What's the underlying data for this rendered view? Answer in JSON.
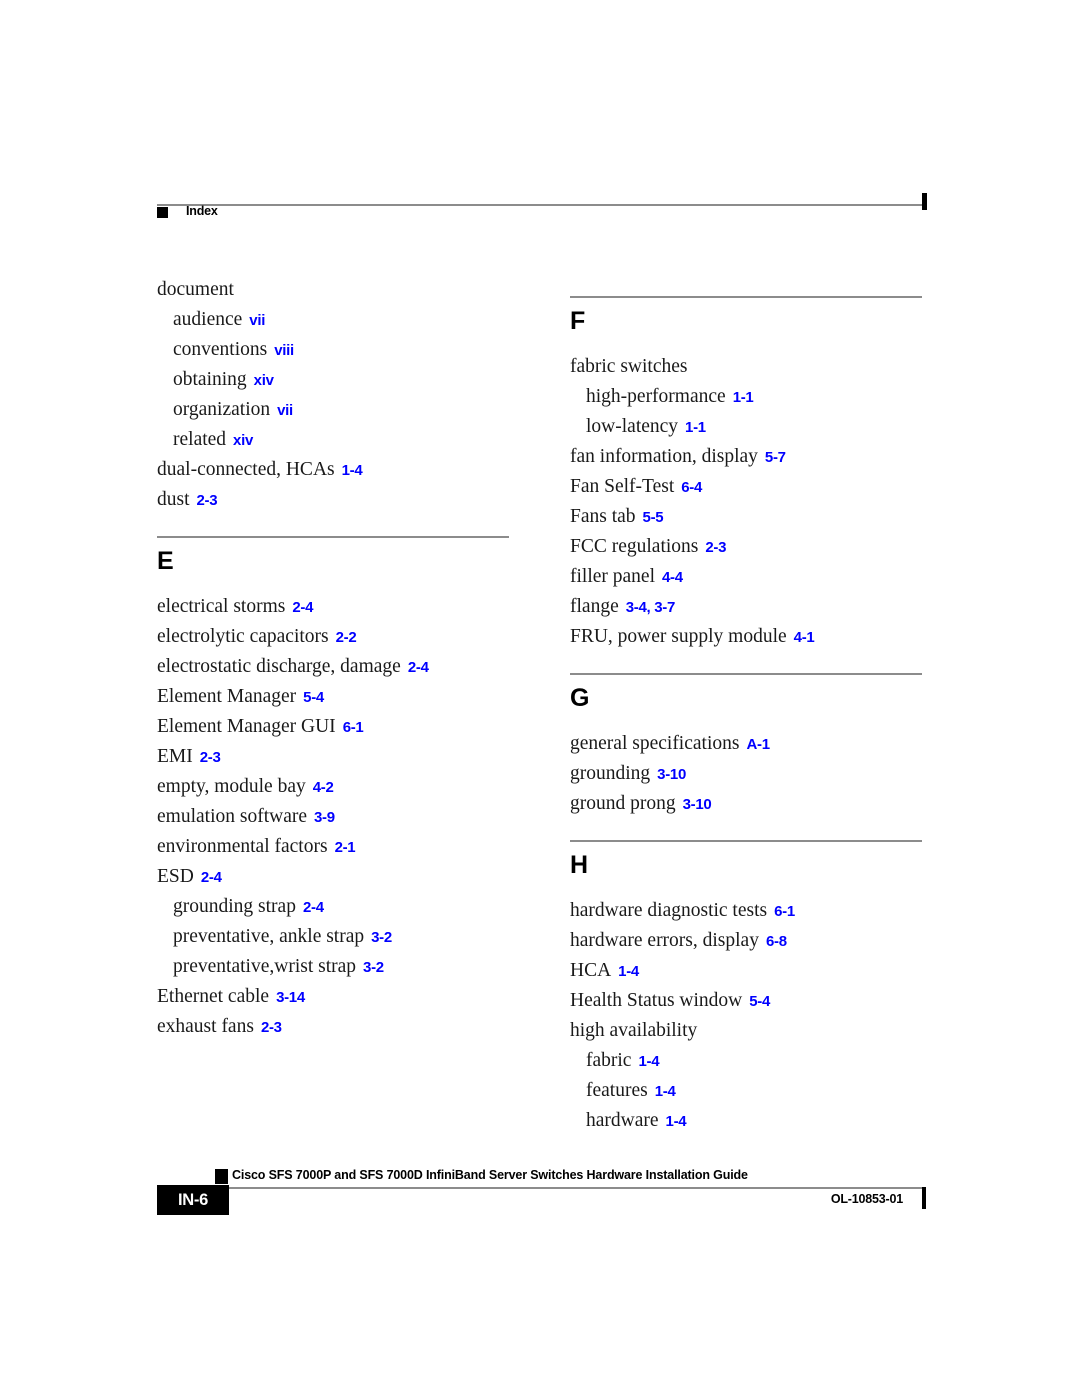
{
  "header": {
    "label": "Index"
  },
  "columns": [
    {
      "name": "left-column",
      "sections": [
        {
          "letter": "",
          "has_divider": false,
          "entries": [
            {
              "term": "document",
              "pages": "",
              "level": 0
            },
            {
              "term": "audience",
              "pages": "vii",
              "level": 1
            },
            {
              "term": "conventions",
              "pages": "viii",
              "level": 1
            },
            {
              "term": "obtaining",
              "pages": "xiv",
              "level": 1
            },
            {
              "term": "organization",
              "pages": "vii",
              "level": 1
            },
            {
              "term": "related",
              "pages": "xiv",
              "level": 1
            },
            {
              "term": "dual-connected, HCAs",
              "pages": "1-4",
              "level": 0
            },
            {
              "term": "dust",
              "pages": "2-3",
              "level": 0
            }
          ]
        },
        {
          "letter": "E",
          "has_divider": true,
          "entries": [
            {
              "term": "electrical storms",
              "pages": "2-4",
              "level": 0
            },
            {
              "term": "electrolytic capacitors",
              "pages": "2-2",
              "level": 0
            },
            {
              "term": "electrostatic discharge, damage",
              "pages": "2-4",
              "level": 0
            },
            {
              "term": "Element Manager",
              "pages": "5-4",
              "level": 0
            },
            {
              "term": "Element Manager GUI",
              "pages": "6-1",
              "level": 0
            },
            {
              "term": "EMI",
              "pages": "2-3",
              "level": 0
            },
            {
              "term": "empty, module bay",
              "pages": "4-2",
              "level": 0
            },
            {
              "term": "emulation software",
              "pages": "3-9",
              "level": 0
            },
            {
              "term": "environmental factors",
              "pages": "2-1",
              "level": 0
            },
            {
              "term": "ESD",
              "pages": "2-4",
              "level": 0
            },
            {
              "term": "grounding strap",
              "pages": "2-4",
              "level": 1
            },
            {
              "term": "preventative, ankle strap",
              "pages": "3-2",
              "level": 1
            },
            {
              "term": "preventative,wrist strap",
              "pages": "3-2",
              "level": 1
            },
            {
              "term": "Ethernet cable",
              "pages": "3-14",
              "level": 0
            },
            {
              "term": "exhaust fans",
              "pages": "2-3",
              "level": 0
            }
          ]
        }
      ]
    },
    {
      "name": "right-column",
      "sections": [
        {
          "letter": "F",
          "has_divider": true,
          "entries": [
            {
              "term": "fabric switches",
              "pages": "",
              "level": 0
            },
            {
              "term": "high-performance",
              "pages": "1-1",
              "level": 1
            },
            {
              "term": "low-latency",
              "pages": "1-1",
              "level": 1
            },
            {
              "term": "fan information, display",
              "pages": "5-7",
              "level": 0
            },
            {
              "term": "Fan Self-Test",
              "pages": "6-4",
              "level": 0
            },
            {
              "term": "Fans tab",
              "pages": "5-5",
              "level": 0
            },
            {
              "term": "FCC regulations",
              "pages": "2-3",
              "level": 0
            },
            {
              "term": "filler panel",
              "pages": "4-4",
              "level": 0
            },
            {
              "term": "flange",
              "pages": "3-4, 3-7",
              "level": 0
            },
            {
              "term": "FRU, power supply module",
              "pages": "4-1",
              "level": 0
            }
          ]
        },
        {
          "letter": "G",
          "has_divider": true,
          "entries": [
            {
              "term": "general specifications",
              "pages": "A-1",
              "level": 0
            },
            {
              "term": "grounding",
              "pages": "3-10",
              "level": 0
            },
            {
              "term": "ground prong",
              "pages": "3-10",
              "level": 0
            }
          ]
        },
        {
          "letter": "H",
          "has_divider": true,
          "entries": [
            {
              "term": "hardware diagnostic tests",
              "pages": "6-1",
              "level": 0
            },
            {
              "term": "hardware errors, display",
              "pages": "6-8",
              "level": 0
            },
            {
              "term": "HCA",
              "pages": "1-4",
              "level": 0
            },
            {
              "term": "Health Status window",
              "pages": "5-4",
              "level": 0
            },
            {
              "term": "high availability",
              "pages": "",
              "level": 0
            },
            {
              "term": "fabric",
              "pages": "1-4",
              "level": 1
            },
            {
              "term": "features",
              "pages": "1-4",
              "level": 1
            },
            {
              "term": "hardware",
              "pages": "1-4",
              "level": 1
            }
          ]
        }
      ]
    }
  ],
  "footer": {
    "title": "Cisco SFS 7000P and SFS 7000D InfiniBand Server Switches Hardware Installation Guide",
    "page_number": "IN-6",
    "doc_id": "OL-10853-01"
  },
  "colors": {
    "page_number_blue": "#0000ff",
    "rule_gray": "#8c8c8c"
  }
}
